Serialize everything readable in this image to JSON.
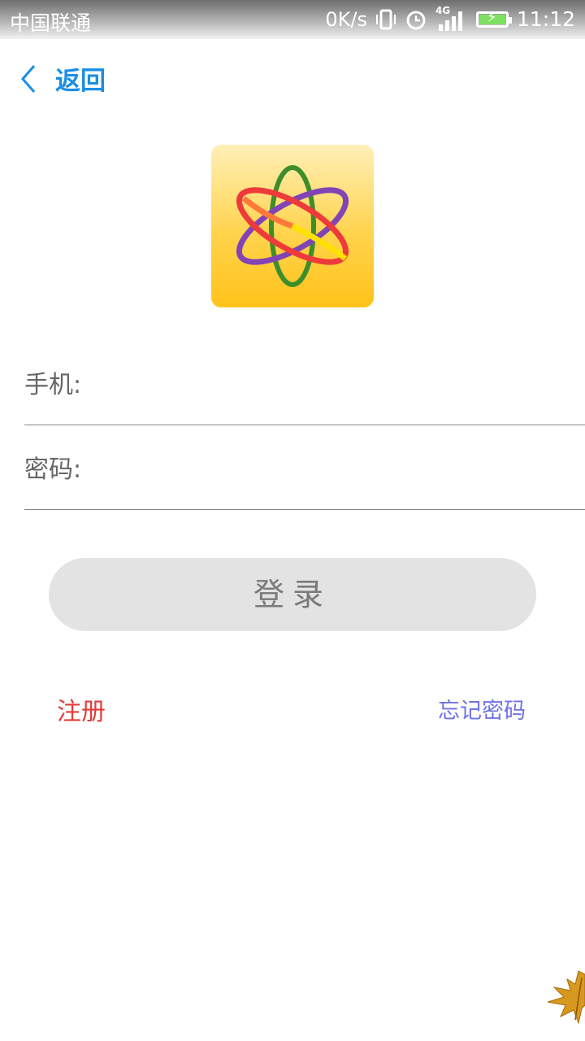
{
  "status_bar": {
    "carrier": "中国联通",
    "net_speed": "0K/s",
    "network_type": "4G",
    "time": "11:12",
    "icons": [
      "vibrate-icon",
      "alarm-icon",
      "signal-icon",
      "battery-charging-icon"
    ]
  },
  "header": {
    "back_label": "返回",
    "back_icon": "chevron-left-icon",
    "accent_color": "#1b8ee6"
  },
  "logo": {
    "icon": "atom-orbits-icon",
    "colors": [
      "#ffd34c",
      "#3e8d2c",
      "#e23b3b",
      "#6a4fb8"
    ]
  },
  "form": {
    "phone_label": "手机:",
    "phone_value": "",
    "password_label": "密码:",
    "password_value": ""
  },
  "actions": {
    "login_label": "登录",
    "register_label": "注册",
    "forgot_label": "忘记密码",
    "register_color": "#e23b3b",
    "forgot_color": "#6f72e8"
  },
  "decoration": {
    "corner_icon": "maple-leaf-icon"
  }
}
